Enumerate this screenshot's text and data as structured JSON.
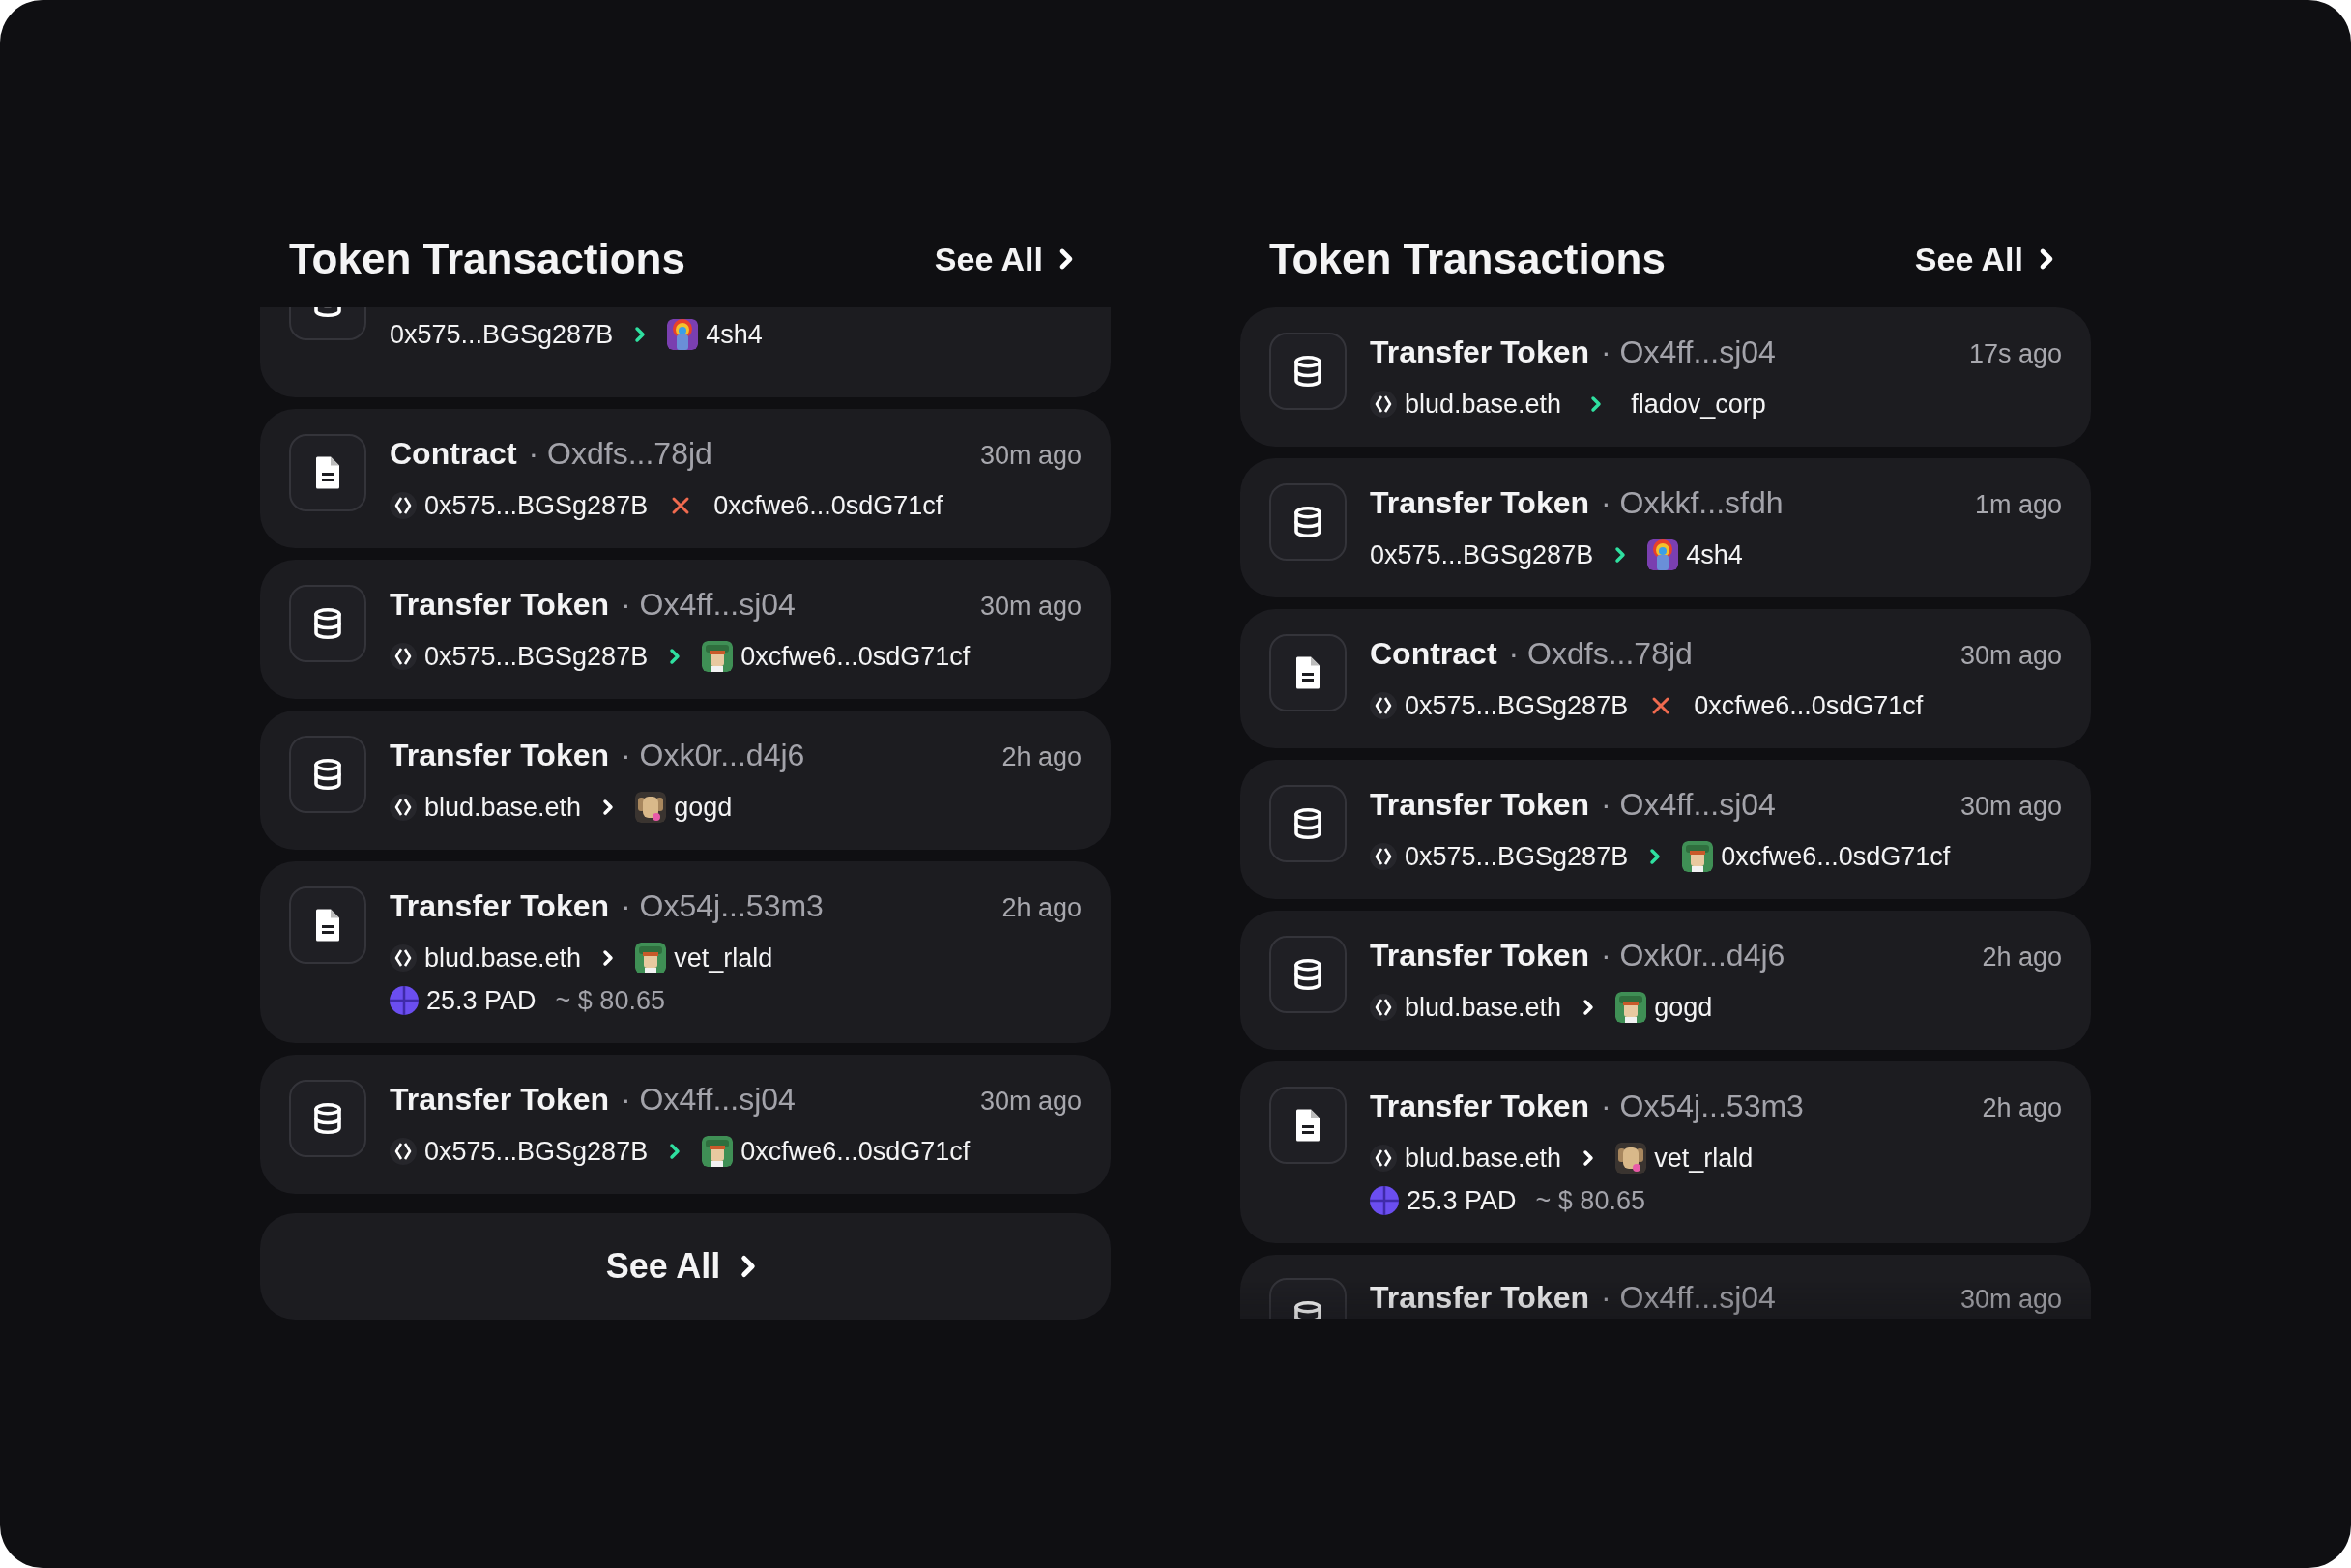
{
  "panels": [
    {
      "title": "Token Transactions",
      "see_all": "See All",
      "footer_button": "See All",
      "peek_above": {
        "kind": "ledger",
        "from": {
          "text": "0x575...BGSg287B",
          "ens": false
        },
        "link": {
          "kind": "arrow",
          "color": "#2fe0a0"
        },
        "to": {
          "text": "4sh4",
          "avatar": true
        }
      },
      "transactions": [
        {
          "kind": "file",
          "title": "Contract",
          "hash": "· Oxdfs...78jd",
          "time": "30m ago",
          "from": {
            "text": "0x575...BGSg287B",
            "ens": true
          },
          "link": {
            "kind": "cross",
            "color": "#f06a4f"
          },
          "to": {
            "text": "0xcfwe6...0sdG71cf",
            "avatar": false
          }
        },
        {
          "kind": "ledger",
          "title": "Transfer Token",
          "hash": "· Ox4ff...sj04",
          "time": "30m ago",
          "from": {
            "text": "0x575...BGSg287B",
            "ens": true
          },
          "link": {
            "kind": "arrow",
            "color": "#2fe0a0"
          },
          "to": {
            "text": "0xcfwe6...0sdG71cf",
            "avatar": true
          }
        },
        {
          "kind": "ledger",
          "title": "Transfer Token",
          "hash": "· Oxk0r...d4j6",
          "time": "2h ago",
          "from": {
            "text": "blud.base.eth",
            "ens": true
          },
          "link": {
            "kind": "arrow",
            "color": "#ffffff"
          },
          "to": {
            "text": "gogd",
            "avatar": true
          }
        },
        {
          "kind": "file",
          "title": "Transfer Token",
          "hash": "· Ox54j...53m3",
          "time": "2h ago",
          "from": {
            "text": "blud.base.eth",
            "ens": true
          },
          "link": {
            "kind": "arrow",
            "color": "#ffffff"
          },
          "to": {
            "text": "vet_rlald",
            "avatar": true
          },
          "amount": {
            "value": "25.3 PAD",
            "usd": "~ $ 80.65"
          }
        },
        {
          "kind": "ledger",
          "title": "Transfer Token",
          "hash": "· Ox4ff...sj04",
          "time": "30m ago",
          "from": {
            "text": "0x575...BGSg287B",
            "ens": true
          },
          "link": {
            "kind": "arrow",
            "color": "#2fe0a0"
          },
          "to": {
            "text": "0xcfwe6...0sdG71cf",
            "avatar": true
          }
        }
      ]
    },
    {
      "title": "Token Transactions",
      "see_all": "See All",
      "transactions": [
        {
          "kind": "ledger",
          "title": "Transfer Token",
          "hash": "· Ox4ff...sj04",
          "time": "17s ago",
          "from": {
            "text": "blud.base.eth",
            "ens": true
          },
          "link": {
            "kind": "arrow",
            "color": "#2fe0a0"
          },
          "to": {
            "text": "fladov_corp",
            "avatar": false
          }
        },
        {
          "kind": "ledger",
          "title": "Transfer Token",
          "hash": "· Oxkkf...sfdh",
          "time": "1m ago",
          "from": {
            "text": "0x575...BGSg287B",
            "ens": false
          },
          "link": {
            "kind": "arrow",
            "color": "#2fe0a0"
          },
          "to": {
            "text": "4sh4",
            "avatar": true
          }
        },
        {
          "kind": "file",
          "title": "Contract",
          "hash": "· Oxdfs...78jd",
          "time": "30m ago",
          "from": {
            "text": "0x575...BGSg287B",
            "ens": true
          },
          "link": {
            "kind": "cross",
            "color": "#f06a4f"
          },
          "to": {
            "text": "0xcfwe6...0sdG71cf",
            "avatar": false
          }
        },
        {
          "kind": "ledger",
          "title": "Transfer Token",
          "hash": "· Ox4ff...sj04",
          "time": "30m ago",
          "from": {
            "text": "0x575...BGSg287B",
            "ens": true
          },
          "link": {
            "kind": "arrow",
            "color": "#2fe0a0"
          },
          "to": {
            "text": "0xcfwe6...0sdG71cf",
            "avatar": true
          }
        },
        {
          "kind": "ledger",
          "title": "Transfer Token",
          "hash": "· Oxk0r...d4j6",
          "time": "2h ago",
          "from": {
            "text": "blud.base.eth",
            "ens": true
          },
          "link": {
            "kind": "arrow",
            "color": "#ffffff"
          },
          "to": {
            "text": "gogd",
            "avatar": true
          }
        },
        {
          "kind": "file",
          "title": "Transfer Token",
          "hash": "· Ox54j...53m3",
          "time": "2h ago",
          "from": {
            "text": "blud.base.eth",
            "ens": true
          },
          "link": {
            "kind": "arrow",
            "color": "#ffffff"
          },
          "to": {
            "text": "vet_rlald",
            "avatar": true
          },
          "amount": {
            "value": "25.3 PAD",
            "usd": "~ $ 80.65"
          }
        }
      ],
      "peek_below": {
        "kind": "ledger",
        "title": "Transfer Token",
        "hash": "· Ox4ff...sj04",
        "time": "30m ago"
      }
    }
  ]
}
